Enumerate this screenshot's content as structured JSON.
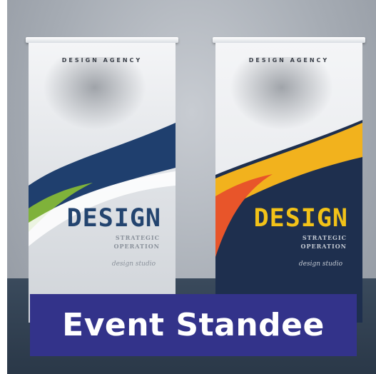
{
  "caption": "Event Standee",
  "standees": [
    {
      "agency": "DESIGN AGENCY",
      "title": "DESIGN",
      "subtitle_1": "STRATEGIC",
      "subtitle_2": "OPERATION",
      "script": "design studio",
      "colors": {
        "wave_main": "#1f3f6e",
        "wave_accent": "#7fb23a",
        "title": "#23446f"
      }
    },
    {
      "agency": "DESIGN AGENCY",
      "title": "DESIGN",
      "subtitle_1": "STRATEGIC",
      "subtitle_2": "OPERATION",
      "script": "design studio",
      "colors": {
        "wave_main": "#f2b21d",
        "wave_accent": "#e8552a",
        "background": "#1e2f4e",
        "title": "#f2c218"
      }
    }
  ],
  "colors": {
    "caption_bg": "#33338a",
    "caption_text": "#ffffff"
  }
}
